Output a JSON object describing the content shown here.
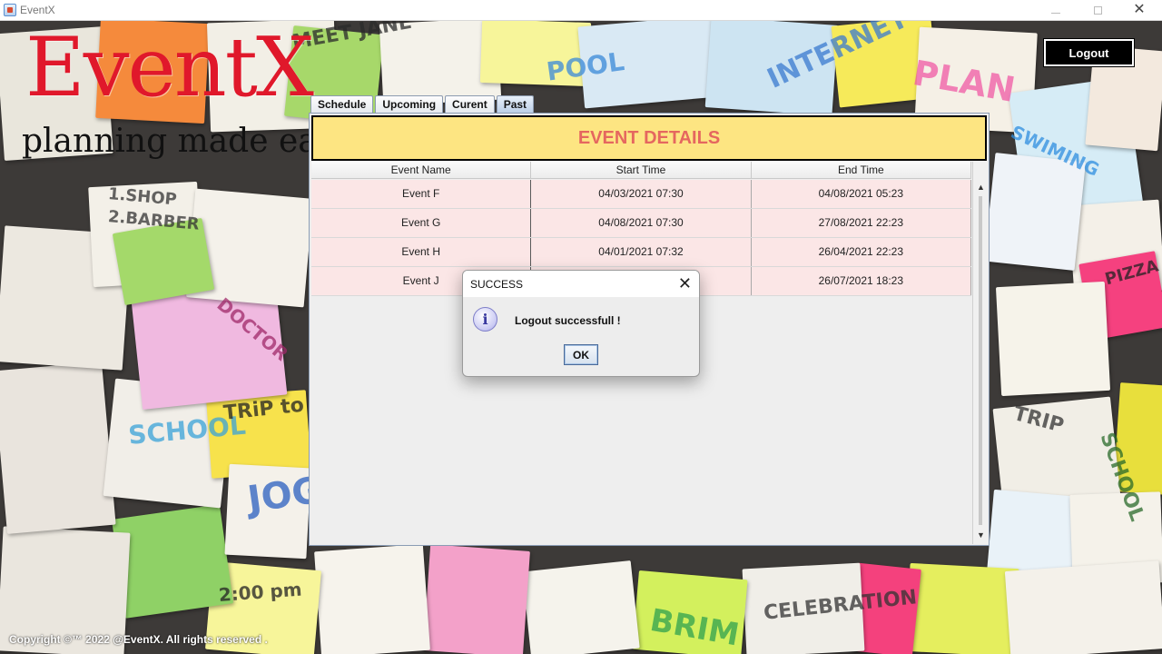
{
  "window": {
    "title": "EventX",
    "minimize_icon": "minimize-icon",
    "maximize_icon": "maximize-icon",
    "close_glyph": "✕"
  },
  "brand": {
    "title": "EventX",
    "subtitle": "planning made easy",
    "title_color": "#e0182b"
  },
  "header": {
    "logout_label": "Logout"
  },
  "tabs": [
    {
      "label": "Schedule"
    },
    {
      "label": "Upcoming"
    },
    {
      "label": "Curent"
    },
    {
      "label": "Past",
      "active": true
    }
  ],
  "panel": {
    "heading": "EVENT DETAILS",
    "heading_bg": "#fde582",
    "heading_color": "#e5675f"
  },
  "table": {
    "columns": [
      "Event Name",
      "Start Time",
      "End Time"
    ],
    "rows": [
      [
        "Event F",
        "04/03/2021  07:30",
        "04/08/2021  05:23"
      ],
      [
        "Event G",
        "04/08/2021  07:30",
        "27/08/2021  22:23"
      ],
      [
        "Event H",
        "04/01/2021  07:32",
        "26/04/2021  22:23"
      ],
      [
        "Event J",
        "",
        "26/07/2021  18:23"
      ]
    ],
    "row_color": "#fbe6e6"
  },
  "dialog": {
    "title": "SUCCESS",
    "close_glyph": "✕",
    "icon": "info-icon",
    "message": "Logout successfull !",
    "ok_label": "OK"
  },
  "footer": {
    "copyright": "Copyright ©™ 2022 @EventX. All rights reserved ."
  }
}
